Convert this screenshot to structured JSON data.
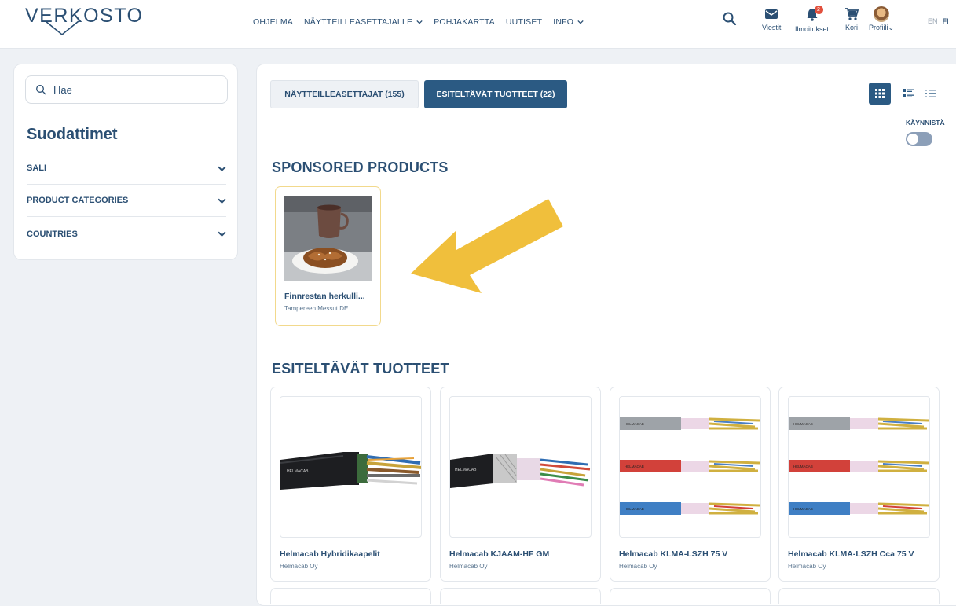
{
  "header": {
    "logo_text": "VERKOSTO",
    "nav": [
      {
        "label": "OHJELMA",
        "dropdown": false
      },
      {
        "label": "NÄYTTEILLEASETTAJALLE",
        "dropdown": true
      },
      {
        "label": "POHJAKARTTA",
        "dropdown": false
      },
      {
        "label": "UUTISET",
        "dropdown": false
      },
      {
        "label": "INFO",
        "dropdown": true
      }
    ],
    "icons": {
      "messages": {
        "label": "Viestit",
        "icon": "envelope-icon"
      },
      "notifications": {
        "label": "Ilmoitukset",
        "icon": "bell-icon",
        "badge": "2"
      },
      "cart": {
        "label": "Kori",
        "icon": "cart-icon"
      },
      "profile": {
        "label": "Profiili"
      }
    },
    "languages": [
      "EN",
      "FI"
    ],
    "active_language": "FI"
  },
  "sidebar": {
    "search_value": "Hae",
    "filters_title": "Suodattimet",
    "filters": [
      "SALI",
      "PRODUCT CATEGORIES",
      "COUNTRIES"
    ]
  },
  "main": {
    "tabs": [
      {
        "label": "NÄYTTEILLEASETTAJAT (155)",
        "active": false
      },
      {
        "label": "ESITELTÄVÄT TUOTTEET (22)",
        "active": true
      }
    ],
    "view_modes": [
      "grid",
      "compact-list",
      "list"
    ],
    "active_view": "grid",
    "toggle_label": "KÄYNNISTÄ",
    "toggle_on": false,
    "sponsored_title": "SPONSORED PRODUCTS",
    "sponsored": [
      {
        "title": "Finnrestan herkulli...",
        "company": "Tampereen Messut DE..."
      }
    ],
    "featured_title": "ESITELTÄVÄT TUOTTEET",
    "products": [
      {
        "title": "Helmacab Hybridikaapelit",
        "company": "Helmacab Oy",
        "image": "black-cable"
      },
      {
        "title": "Helmacab KJAAM-HF GM",
        "company": "Helmacab Oy",
        "image": "black-cable-shielded"
      },
      {
        "title": "Helmacab KLMA-LSZH 75 V",
        "company": "Helmacab Oy",
        "image": "colored-cables"
      },
      {
        "title": "Helmacab KLMA-LSZH Cca 75 V",
        "company": "Helmacab Oy",
        "image": "colored-cables"
      }
    ]
  },
  "colors": {
    "brand": "#2b4f73",
    "active_tab": "#2b5a83",
    "sponsored_border": "#f2d98c",
    "arrow": "#f0bf3c",
    "badge": "#e2503d"
  }
}
